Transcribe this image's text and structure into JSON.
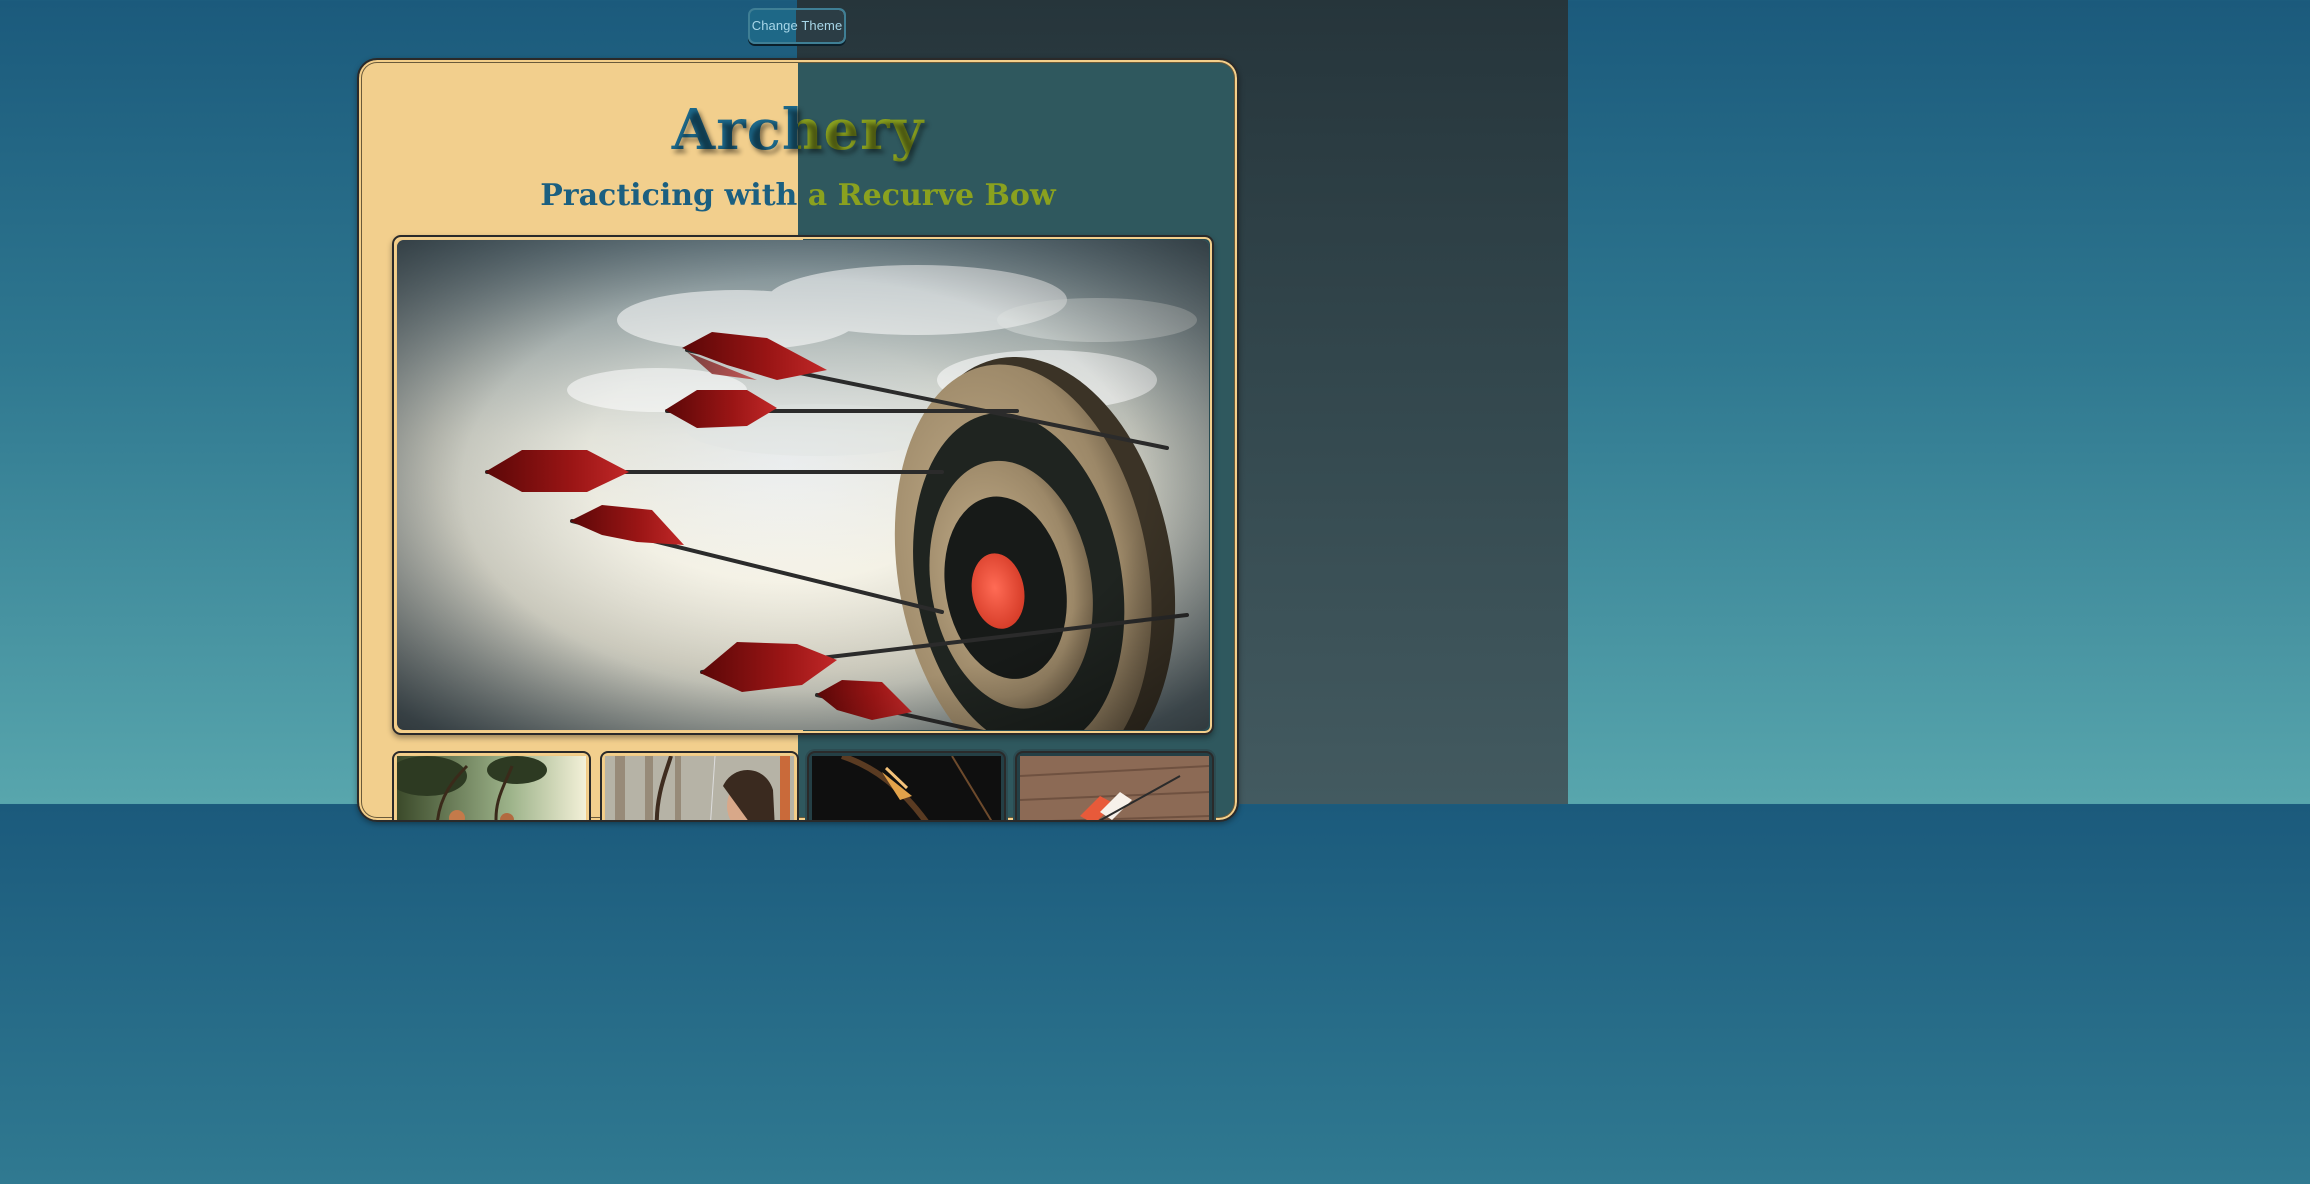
{
  "controls": {
    "theme_button_label": "Change Theme"
  },
  "page": {
    "title": "Archery",
    "subtitle": "Practicing with a Recurve Bow"
  },
  "images": {
    "hero": "arrows-hitting-target",
    "thumbnails": [
      "archers-in-forest",
      "archer-portrait",
      "bow-closeup",
      "arrows-on-wood"
    ]
  },
  "colors": {
    "light_theme_heading": "#1d6a8c",
    "dark_theme_heading": "#8aa11f",
    "light_card": "#f2cf8d",
    "dark_card": "#2f585e"
  }
}
